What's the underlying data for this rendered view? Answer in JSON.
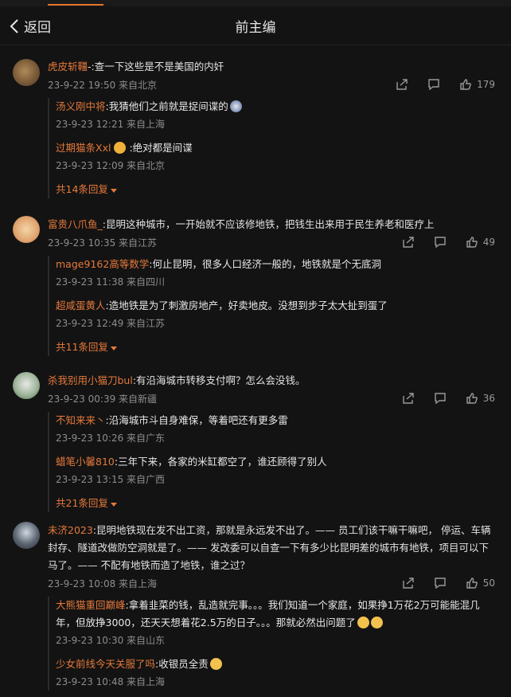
{
  "header": {
    "back_label": "返回",
    "title": "前主编"
  },
  "comments": [
    {
      "user": "虎皮斩韁",
      "text": "-:查一下这些是不是美国的内奸",
      "meta": "23-9-22 19:50 来自北京",
      "likes": "179",
      "replies": [
        {
          "user": "汤义刚中将",
          "text": ":我猜他们之前就是捉间谍的",
          "meta": "23-9-23 12:21 来自上海"
        },
        {
          "user": "过期猫条Xxl",
          "text": ":绝对都是间谍",
          "meta": "23-9-23 12:09 来自北京"
        }
      ],
      "more": "共14条回复"
    },
    {
      "user": "富贵八爪鱼_",
      "text": ":昆明这种城市，一开始就不应该修地铁，把钱生出来用于民生养老和医疗上",
      "meta": "23-9-23 10:35 来自江苏",
      "likes": "49",
      "replies": [
        {
          "user": "mage9162高等数学",
          "text": ":何止昆明，很多人口经济一般的，地铁就是个无底洞",
          "meta": "23-9-23 11:38 来自四川"
        },
        {
          "user": "超咸蛋黄人",
          "text": ":造地铁是为了刺激房地产，好卖地皮。没想到步子太大扯到蛋了",
          "meta": "23-9-23 12:49 来自江苏"
        }
      ],
      "more": "共11条回复"
    },
    {
      "user": "杀我别用小猫刀bul",
      "text": ":有沿海城市转移支付啊？怎么会没钱。",
      "meta": "23-9-23 00:39 来自新疆",
      "likes": "36",
      "replies": [
        {
          "user": "不知来来丶",
          "text": ":沿海城市斗自身难保，等着吧还有更多雷",
          "meta": "23-9-23 10:26 来自广东"
        },
        {
          "user": "蜡笔小馨810",
          "text": ":三年下来，各家的米缸都空了，谁还顾得了别人",
          "meta": "23-9-23 13:15 来自广西"
        }
      ],
      "more": "共21条回复"
    },
    {
      "user": "未济2023",
      "text": ":昆明地铁现在发不出工资，那就是永远发不出了。—— 员工们该干嘛干嘛吧， 停运、车辆封存、隧道改做防空洞就是了。—— 发改委可以自查一下有多少比昆明差的城市有地铁，项目可以下马了。—— 不配有地铁而造了地铁，谁之过？",
      "meta": "23-9-23 10:08 来自上海",
      "likes": "50",
      "replies": [
        {
          "user": "大熊猫重回巅峰",
          "text": ":拿着韭菜的钱，乱造就完事。。。我们知道一个家庭，如果挣1万花2万可能能混几年，但放挣3000，还天天想着花2.5万的日子。。。那就必然出问题了",
          "meta": "23-9-23 10:30 来自山东"
        },
        {
          "user": "少女前线今天关服了吗",
          "text": ":收银员全责",
          "meta": "23-9-23 10:48 来自上海"
        }
      ]
    }
  ],
  "colors": {
    "accent": "#e5793b",
    "background": "#131313",
    "meta": "#8d8d8d"
  },
  "icons": [
    "back-chevron-icon",
    "share-icon",
    "comment-icon",
    "like-icon"
  ]
}
